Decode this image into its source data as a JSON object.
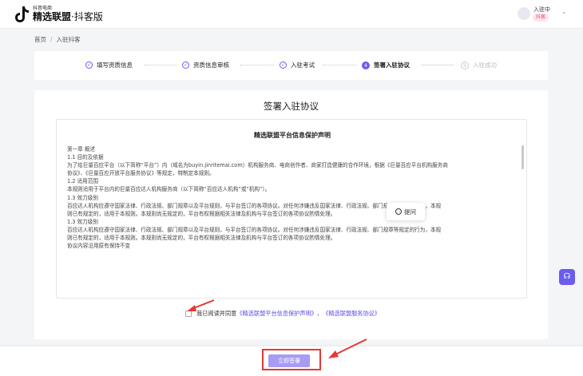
{
  "header": {
    "brand_sub": "抖音电商",
    "brand_name": "精选联盟",
    "brand_suffix": "·抖客版",
    "user_status": "入驻中",
    "user_badge": "抖客"
  },
  "breadcrumb": {
    "home": "首页",
    "separator": "/",
    "current": "入驻抖客"
  },
  "steps": [
    {
      "label": "填写资质信息",
      "state": "done"
    },
    {
      "label": "资质信息审核",
      "state": "done"
    },
    {
      "label": "入驻考试",
      "state": "done"
    },
    {
      "label": "签署入驻协议",
      "state": "current",
      "number": "4"
    },
    {
      "label": "入驻成功",
      "state": "pending",
      "number": "5"
    }
  ],
  "card_title": "签署入驻协议",
  "document": {
    "title": "精选联盟平台信息保护声明",
    "lines": [
      "第一章 概述",
      "1.1 目的及依据",
      "为了给巨量百应平台（以下简称“平台”）内（域名为buyin.jinritemai.com）机构服务商、电商创作者、商家打造健康的合作环境，根据《巨量百应平台机构服务商",
      "协议》、《巨量百应开放平台服务协议》等规定，特制定本规则。",
      "1.2 适用范围",
      "本规则适用于平台内的巨量百应达人机构服务商（以下简称“百应达人机构”或“机构”）。",
      "1.3 效力级别",
      "百应达人机构应遵守国家法律、行政法规、部门规章以及平台规则，与平台签订的各项协议。对任何涉嫌违反国家法律、行政法规、部门规章等规定的行为，本规",
      "则已有规定的，适用于本规则。本规则尚无规定的，平台有权根据相关法律及机构与平台签订的各项协议酌情处理。",
      "1.3 效力级别",
      "百应达人机构应遵守国家法律、行政法规、部门规章以及平台规则，与平台签订的各项协议。对任何涉嫌违反国家法律、行政法规、部门规章等规定的行为，本规",
      "则已有规定的，适用于本规则。本规则尚无规定的，平台有权根据相关法律及机构与平台签订的各项协议酌情处理。",
      "协议内容沿用原有保持不变"
    ]
  },
  "ask_button": "提问",
  "agreement": {
    "prefix": "我已阅读并同意",
    "link1": "《精选联盟平台信息保护声明》",
    "separator": "、",
    "link2": "《精选联盟服务协议》",
    "checked": false
  },
  "submit_label": "立即签署",
  "colors": {
    "accent": "#6b5cf0",
    "disabled_button": "#a79cf5",
    "annotation": "#e53935",
    "link": "#5a4de8"
  }
}
